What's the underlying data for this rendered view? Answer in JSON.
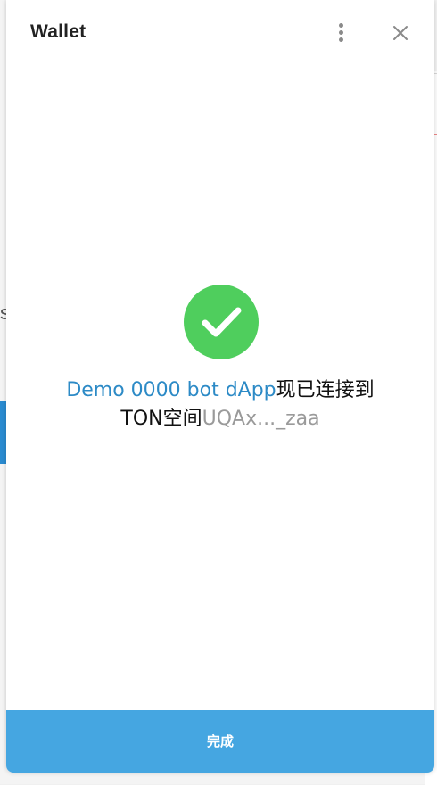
{
  "header": {
    "title": "Wallet",
    "menu_icon": "more-vertical-icon",
    "close_icon": "close-icon"
  },
  "main": {
    "status_icon": "check-circle-icon",
    "app_name": "Demo 0000 bot dApp",
    "connected_text_line1": "现已连接到",
    "connected_text_line2": "TON空间",
    "wallet_address": "UQAx..._zaa"
  },
  "footer": {
    "done_label": "完成"
  },
  "colors": {
    "accent": "#45a6e1",
    "link": "#2c8ac6",
    "success": "#4fce5d",
    "muted": "#9a9a9a"
  }
}
